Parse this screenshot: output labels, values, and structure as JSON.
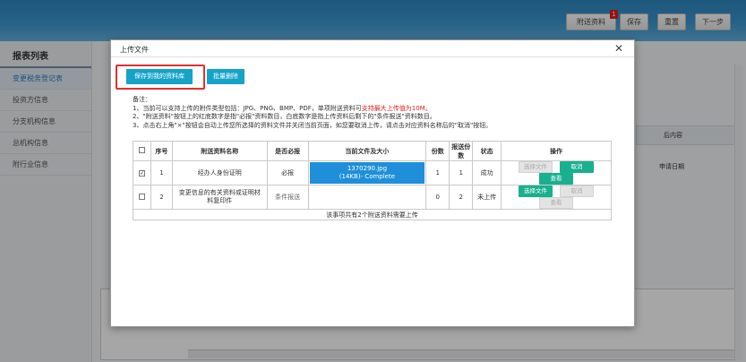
{
  "header": {
    "buttons": [
      "附送资料",
      "保存",
      "重置",
      "下一步"
    ],
    "attachment_badge": "1"
  },
  "sidebar": {
    "title": "报表列表",
    "items": [
      {
        "label": "变更税务登记表",
        "active": true
      },
      {
        "label": "投资方信息",
        "active": false
      },
      {
        "label": "分支机构信息",
        "active": false
      },
      {
        "label": "总机构信息",
        "active": false
      },
      {
        "label": "附行业信息",
        "active": false
      }
    ]
  },
  "background": {
    "table_header": "后内容",
    "table_cell": "申请日期"
  },
  "modal": {
    "title": "上传文件",
    "close_glyph": "✕",
    "buttons": {
      "save_to_library": "保存到我的资料库",
      "batch_delete": "批量删除"
    },
    "notes": {
      "heading": "备注：",
      "line1_prefix": "1、当前可以支持上传的附件类型包括：JPG、PNG、BMP、PDF，单项附送资料可",
      "line1_red": "支持最大上传值为10M。",
      "line2": "2、\"附送资料\"按钮上的红底数字是指\"必报\"资料数目，白底数字是指上传资料后剩下的\"条件报送\"资料数目。",
      "line3": "3、点击右上角\"×\"按钮会自动上传您所选择的资料文件并关闭当前页面，如您要取消上传，请点击对应资料名称后的\"取消\"按钮。"
    },
    "table": {
      "headers": {
        "checkbox": "",
        "index": "序号",
        "name": "附送资料名称",
        "required": "是否必报",
        "file": "当前文件及大小",
        "copies": "份数",
        "submitted_copies": "报送份数",
        "status": "状态",
        "actions": "操作"
      },
      "rows": [
        {
          "checked": "✓",
          "index": "1",
          "name": "经办人身份证明",
          "required": "必报",
          "file_name": "1370290.jpg",
          "file_size": "(14KB)- Complete",
          "copies": "1",
          "submitted_copies": "1",
          "status": "成功",
          "btn_select": "选择文件",
          "btn_cancel": "取消",
          "btn_view": "查看"
        },
        {
          "checked": "",
          "index": "2",
          "name": "变更信息的有关资料或证明材料复印件",
          "required": "条件报送",
          "file_name": "",
          "file_size": "",
          "copies": "0",
          "submitted_copies": "2",
          "status": "未上传",
          "btn_select": "选择文件",
          "btn_cancel": "取消",
          "btn_view": "查看"
        }
      ],
      "footer": "该事项共有2个附送资料需要上传"
    }
  },
  "colors": {
    "header_blue": "#3a96cf",
    "button_cyan": "#15a3c8",
    "file_blue": "#1e8fd8",
    "action_green": "#18b08f",
    "highlight_red": "#e03030"
  }
}
